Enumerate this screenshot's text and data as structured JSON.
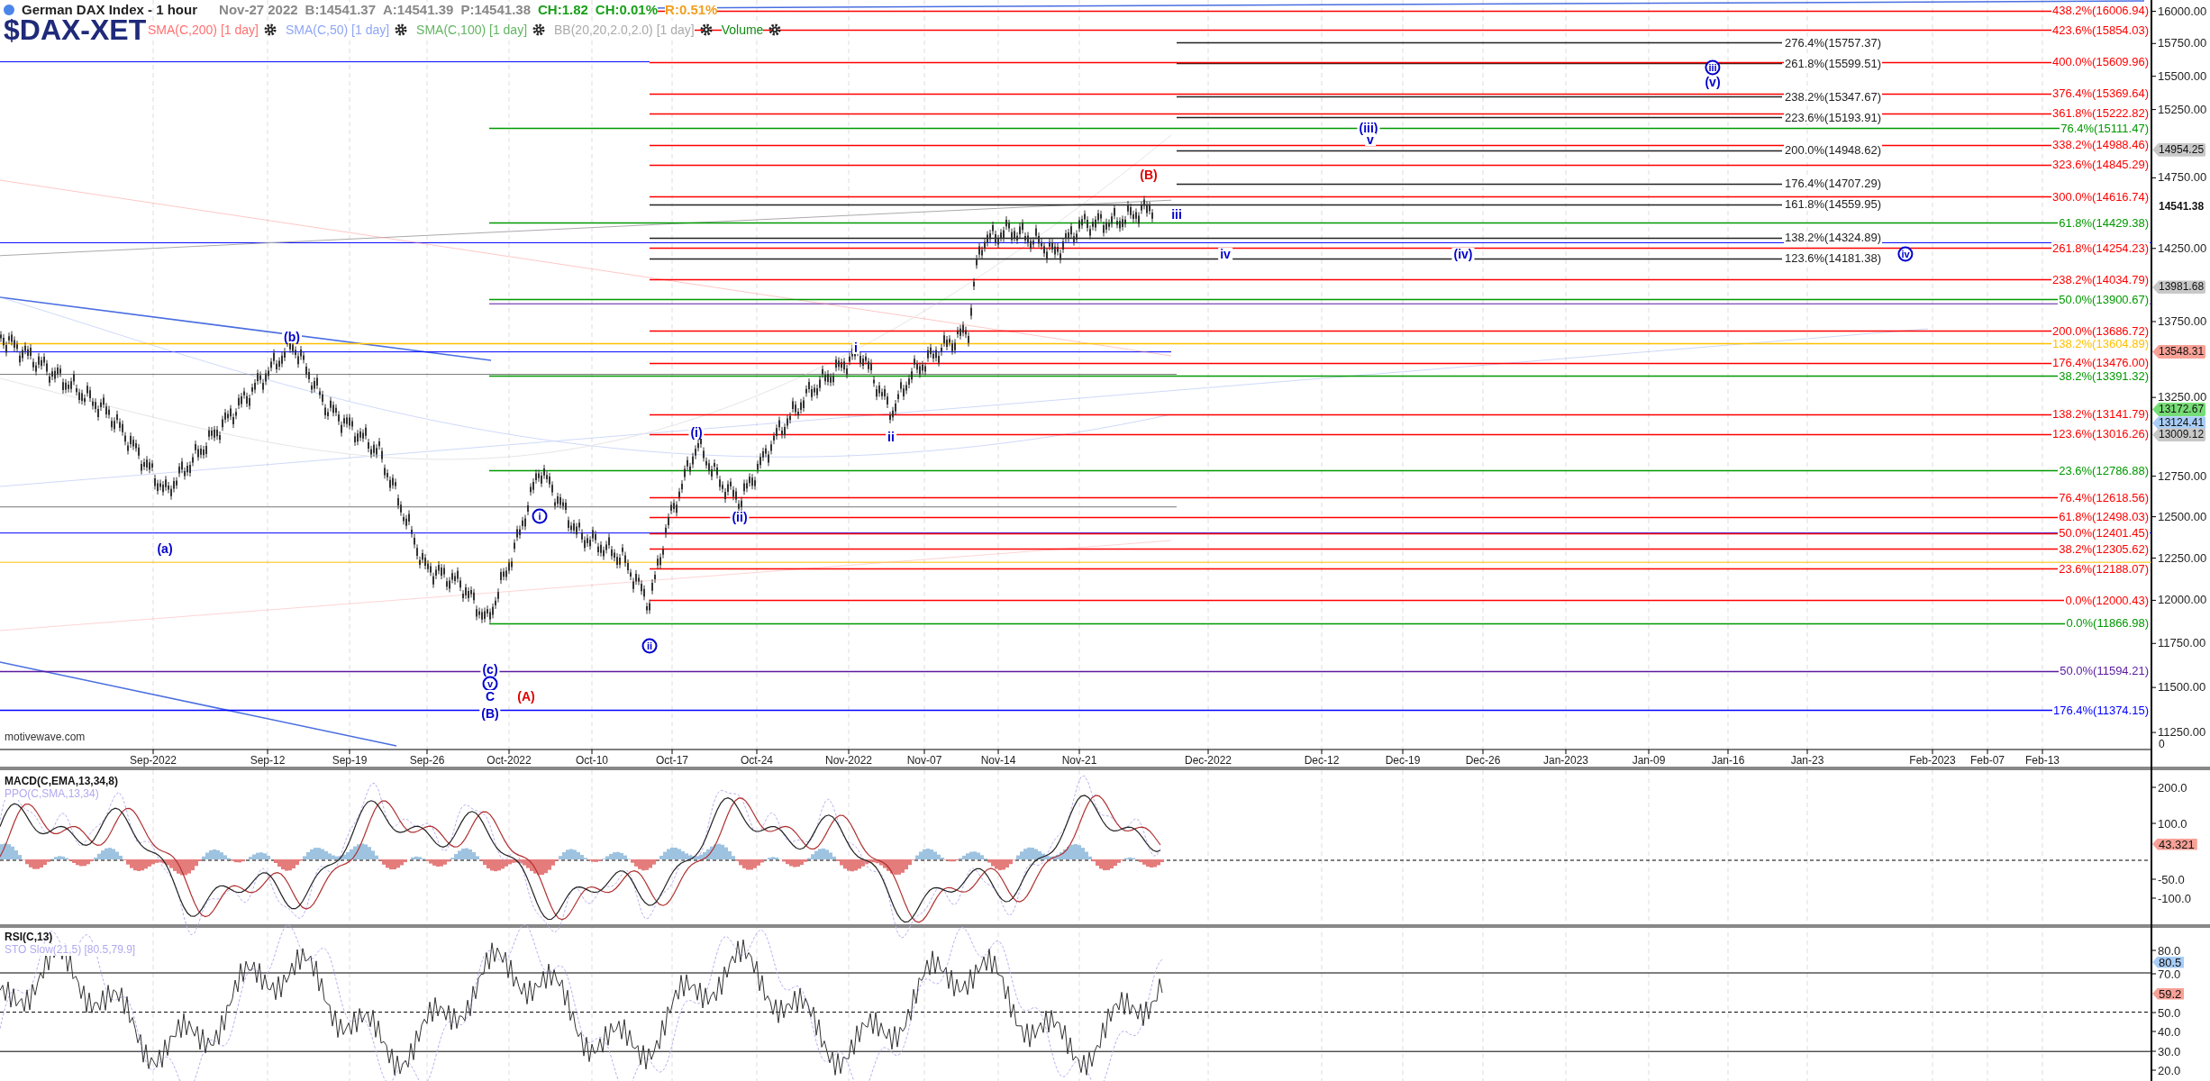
{
  "header": {
    "title": "German DAX Index - 1 hour",
    "date": "Nov-27 2022",
    "quotes": [
      {
        "text": "B:14541.37",
        "kind": "price"
      },
      {
        "text": "A:14541.39",
        "kind": "price"
      },
      {
        "text": "P:14541.38",
        "kind": "price"
      },
      {
        "text": "CH:1.82",
        "kind": "change"
      },
      {
        "text": "CH:0.01%",
        "kind": "change"
      },
      {
        "text": "R:0.51%",
        "kind": "range"
      }
    ]
  },
  "symbol": "$DAX-XET",
  "indicators": [
    {
      "label": "SMA(C,200) [1 day]",
      "color": "#ff7070"
    },
    {
      "label": "SMA(C,50) [1 day]",
      "color": "#8ea6f5"
    },
    {
      "label": "SMA(C,100) [1 day]",
      "color": "#62b562"
    },
    {
      "label": "BB(20,20,2.0,2.0) [1 day]",
      "color": "#aaaaaa"
    },
    {
      "label": "Volume",
      "color": "#138a13"
    }
  ],
  "fib_levels": [
    {
      "label": "438.2%(16006.94)",
      "color": "#ff0000",
      "kind": "right"
    },
    {
      "label": "423.6%(15854.03)",
      "color": "#ff0000",
      "kind": "right"
    },
    {
      "label": "276.4%(15757.37)",
      "color": "#222222",
      "kind": "middle"
    },
    {
      "label": "261.8%(15599.51)",
      "color": "#222222",
      "kind": "middle"
    },
    {
      "label": "400.0%(15609.96)",
      "color": "#ff0000",
      "kind": "right"
    },
    {
      "label": "238.2%(15347.67)",
      "color": "#222222",
      "kind": "middle"
    },
    {
      "label": "376.4%(15369.64)",
      "color": "#ff0000",
      "kind": "right"
    },
    {
      "label": "223.6%(15193.91)",
      "color": "#222222",
      "kind": "middle"
    },
    {
      "label": "361.8%(15222.82)",
      "color": "#ff0000",
      "kind": "right"
    },
    {
      "label": "76.4%(15111.47)",
      "color": "#009900",
      "kind": "right"
    },
    {
      "label": "200.0%(14948.62)",
      "color": "#222222",
      "kind": "middle"
    },
    {
      "label": "338.2%(14988.46)",
      "color": "#ff0000",
      "kind": "right"
    },
    {
      "label": "323.6%(14845.29)",
      "color": "#ff0000",
      "kind": "right"
    },
    {
      "label": "176.4%(14707.29)",
      "color": "#222222",
      "kind": "middle"
    },
    {
      "label": "300.0%(14616.74)",
      "color": "#ff0000",
      "kind": "right"
    },
    {
      "label": "161.8%(14559.95)",
      "color": "#222222",
      "kind": "middle"
    },
    {
      "label": "61.8%(14429.38)",
      "color": "#009900",
      "kind": "right"
    },
    {
      "label": "138.2%(14324.89)",
      "color": "#222222",
      "kind": "middle"
    },
    {
      "label": "261.8%(14254.23)",
      "color": "#ff0000",
      "kind": "right"
    },
    {
      "label": "123.6%(14181.38)",
      "color": "#222222",
      "kind": "middle"
    },
    {
      "label": "238.2%(14034.79)",
      "color": "#ff0000",
      "kind": "right"
    },
    {
      "label": "50.0%(13900.67)",
      "color": "#009900",
      "kind": "right"
    },
    {
      "label": "200.0%(13686.72)",
      "color": "#ff0000",
      "kind": "right"
    },
    {
      "label": "138.2%(13604.89)",
      "color": "#ffc000",
      "kind": "right"
    },
    {
      "label": "176.4%(13476.00)",
      "color": "#ff0000",
      "kind": "right"
    },
    {
      "label": "38.2%(13391.32)",
      "color": "#009900",
      "kind": "right"
    },
    {
      "label": "138.2%(13141.79)",
      "color": "#ff0000",
      "kind": "right"
    },
    {
      "label": "123.6%(13016.26)",
      "color": "#ff0000",
      "kind": "right"
    },
    {
      "label": "23.6%(12786.88)",
      "color": "#009900",
      "kind": "right"
    },
    {
      "label": "76.4%(12618.56)",
      "color": "#ff0000",
      "kind": "right"
    },
    {
      "label": "61.8%(12498.03)",
      "color": "#ff0000",
      "kind": "right"
    },
    {
      "label": "50.0%(12401.45)",
      "color": "#ff0000",
      "kind": "right"
    },
    {
      "label": "38.2%(12305.62)",
      "color": "#ff0000",
      "kind": "right"
    },
    {
      "label": "23.6%(12188.07)",
      "color": "#ff0000",
      "kind": "right"
    },
    {
      "label": "0.0%(12000.43)",
      "color": "#ff0000",
      "kind": "right"
    },
    {
      "label": "0.0%(11866.98)",
      "color": "#009900",
      "kind": "right"
    },
    {
      "label": "50.0%(11594.21)",
      "color": "#5a1aa0",
      "kind": "right"
    },
    {
      "label": "176.4%(11374.15)",
      "color": "#0000ff",
      "kind": "right"
    }
  ],
  "wave_labels": [
    {
      "text": "(a)",
      "kind": "plain",
      "color": "#0000cc"
    },
    {
      "text": "(b)",
      "kind": "plain",
      "color": "#0000cc"
    },
    {
      "text": "(c)",
      "kind": "plain",
      "color": "#0000cc"
    },
    {
      "text": "v",
      "kind": "circled",
      "color": "#0000cc"
    },
    {
      "text": "C",
      "kind": "plain",
      "color": "#0000cc"
    },
    {
      "text": "(B)",
      "kind": "plain",
      "color": "#0000cc"
    },
    {
      "text": "(A)",
      "kind": "plain",
      "color": "#dd0000"
    },
    {
      "text": "i",
      "kind": "circled",
      "color": "#0000cc"
    },
    {
      "text": "ii",
      "kind": "circled",
      "color": "#0000cc"
    },
    {
      "text": "(i)",
      "kind": "plain",
      "color": "#0000cc"
    },
    {
      "text": "(ii)",
      "kind": "plain",
      "color": "#0000cc"
    },
    {
      "text": "i",
      "kind": "plain",
      "color": "#0000cc"
    },
    {
      "text": "ii",
      "kind": "plain",
      "color": "#0000cc"
    },
    {
      "text": "(B)",
      "kind": "plain",
      "color": "#dd0000"
    },
    {
      "text": "iii",
      "kind": "plain",
      "color": "#0000cc"
    },
    {
      "text": "iv",
      "kind": "plain",
      "color": "#0000cc"
    },
    {
      "text": "(iii)",
      "kind": "plain",
      "color": "#0000cc"
    },
    {
      "text": "v",
      "kind": "plain",
      "color": "#0000cc"
    },
    {
      "text": "(iv)",
      "kind": "plain",
      "color": "#0000cc"
    },
    {
      "text": "iii",
      "kind": "circled",
      "color": "#0000cc"
    },
    {
      "text": "(v)",
      "kind": "plain",
      "color": "#0000cc"
    },
    {
      "text": "iv",
      "kind": "circled",
      "color": "#0000cc"
    }
  ],
  "price_axis": {
    "ticks": [
      "16000.00",
      "15750.00",
      "15500.00",
      "15250.00",
      "14750.00",
      "14250.00",
      "13750.00",
      "13250.00",
      "12750.00",
      "12500.00",
      "12250.00",
      "12000.00",
      "11750.00",
      "11500.00",
      "11250.00"
    ],
    "tags": [
      {
        "text": "14954.25",
        "color": "#c8c8c8"
      },
      {
        "text": "14541.38",
        "color": "#ffffff"
      },
      {
        "text": "13981.68",
        "color": "#c8c8c8"
      },
      {
        "text": "13548.31",
        "color": "#f7a197"
      },
      {
        "text": "13172.67",
        "color": "#77dd77"
      },
      {
        "text": "13124.41",
        "color": "#a8cdf7"
      },
      {
        "text": "13009.12",
        "color": "#c8c8c8"
      },
      {
        "text": "0",
        "color": "#ffffff"
      }
    ]
  },
  "time_axis": [
    "Sep-2022",
    "Sep-12",
    "Sep-19",
    "Sep-26",
    "Oct-2022",
    "Oct-10",
    "Oct-17",
    "Oct-24",
    "Nov-2022",
    "Nov-07",
    "Nov-14",
    "Nov-21",
    "Dec-2022",
    "Dec-12",
    "Dec-19",
    "Dec-26",
    "Jan-2023",
    "Jan-09",
    "Jan-16",
    "Jan-23",
    "Feb-2023",
    "Feb-07",
    "Feb-13"
  ],
  "source": "motivewave.com",
  "macd_panel": {
    "title": "MACD(C,EMA,13,34,8)",
    "subtitle": "PPO(C,SMA,13,34)",
    "axis_ticks": [
      "200.0",
      "100.0",
      "-50.0",
      "-100.0"
    ],
    "tags": [
      {
        "text": "43.321",
        "color": "#f7a197"
      }
    ]
  },
  "rsi_panel": {
    "title": "RSI(C,13)",
    "subtitle": "STO Slow(21,5) [80.5,79.9]",
    "axis_ticks": [
      "80.0",
      "70.0",
      "50.0",
      "40.0",
      "30.0",
      "20.0"
    ],
    "tags": [
      {
        "text": "80.5",
        "color": "#a8cdf7"
      },
      {
        "text": "59.2",
        "color": "#f7a197"
      }
    ]
  }
}
